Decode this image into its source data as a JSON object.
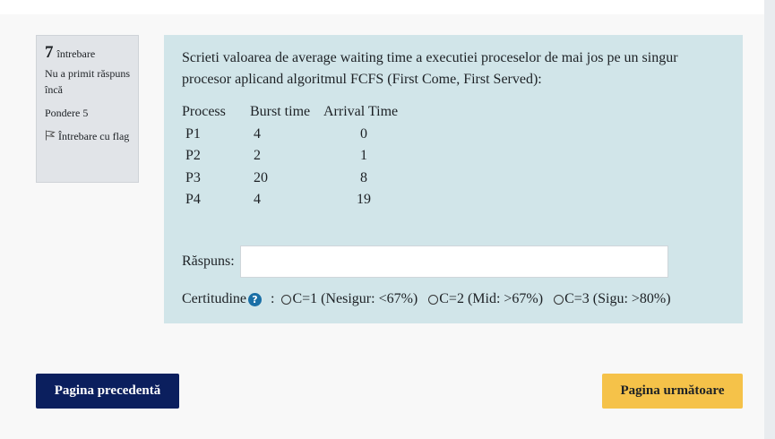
{
  "info": {
    "number": "7",
    "number_label": "întrebare",
    "status": "Nu a primit răspuns încă",
    "grade": "Pondere 5",
    "flag_label": "Întrebare cu flag",
    "flag_icon": "flag-outline-icon"
  },
  "question": {
    "text": "Scrieti valoarea de average waiting time a executiei proceselor de mai jos pe un singur procesor aplicand algoritmul FCFS (First Come, First Served):",
    "table": {
      "headers": [
        "Process",
        "Burst time",
        "Arrival Time"
      ],
      "rows": [
        [
          "P1",
          "4",
          "0"
        ],
        [
          "P2",
          "2",
          "1"
        ],
        [
          "P3",
          "20",
          "8"
        ],
        [
          "P4",
          "4",
          "19"
        ]
      ]
    },
    "answer_label": "Răspuns:",
    "answer_value": ""
  },
  "certainty": {
    "label": "Certitudine",
    "help_icon": "question-circle-icon",
    "separator": ":",
    "options": [
      "C=1 (Nesigur: <67%)",
      "C=2 (Mid: >67%)",
      "C=3 (Sigu: >80%)"
    ]
  },
  "nav": {
    "prev_label": "Pagina precedentă",
    "next_label": "Pagina următoare"
  },
  "colors": {
    "content_bg": "#d1e5e9",
    "info_bg": "#e1e4e8",
    "prev_button": "#0b1f5e",
    "next_button": "#f5c249"
  }
}
